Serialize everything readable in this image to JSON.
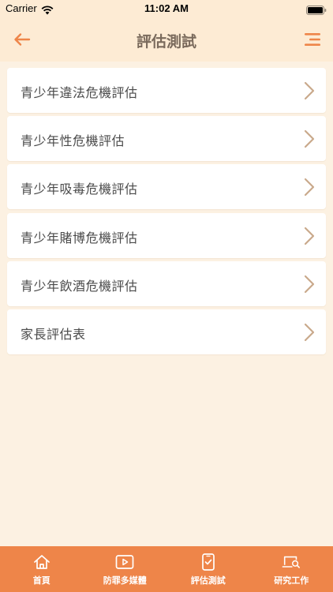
{
  "status": {
    "carrier": "Carrier",
    "time": "11:02 AM"
  },
  "header": {
    "title": "評估測試",
    "back_icon": "arrow-left-icon",
    "menu_icon": "menu-icon",
    "accent_color": "#ee8549"
  },
  "list": {
    "items": [
      {
        "label": "青少年違法危機評估"
      },
      {
        "label": "青少年性危機評估"
      },
      {
        "label": "青少年吸毒危機評估"
      },
      {
        "label": "青少年賭博危機評估"
      },
      {
        "label": "青少年飲酒危機評估"
      },
      {
        "label": "家長評估表"
      }
    ]
  },
  "tab_bar": {
    "background": "#ee8549",
    "tabs": [
      {
        "label": "首頁",
        "icon": "home-icon"
      },
      {
        "label": "防罪多媒體",
        "icon": "play-video-icon"
      },
      {
        "label": "評估測試",
        "icon": "phone-check-icon"
      },
      {
        "label": "研究工作",
        "icon": "laptop-search-icon"
      }
    ]
  }
}
